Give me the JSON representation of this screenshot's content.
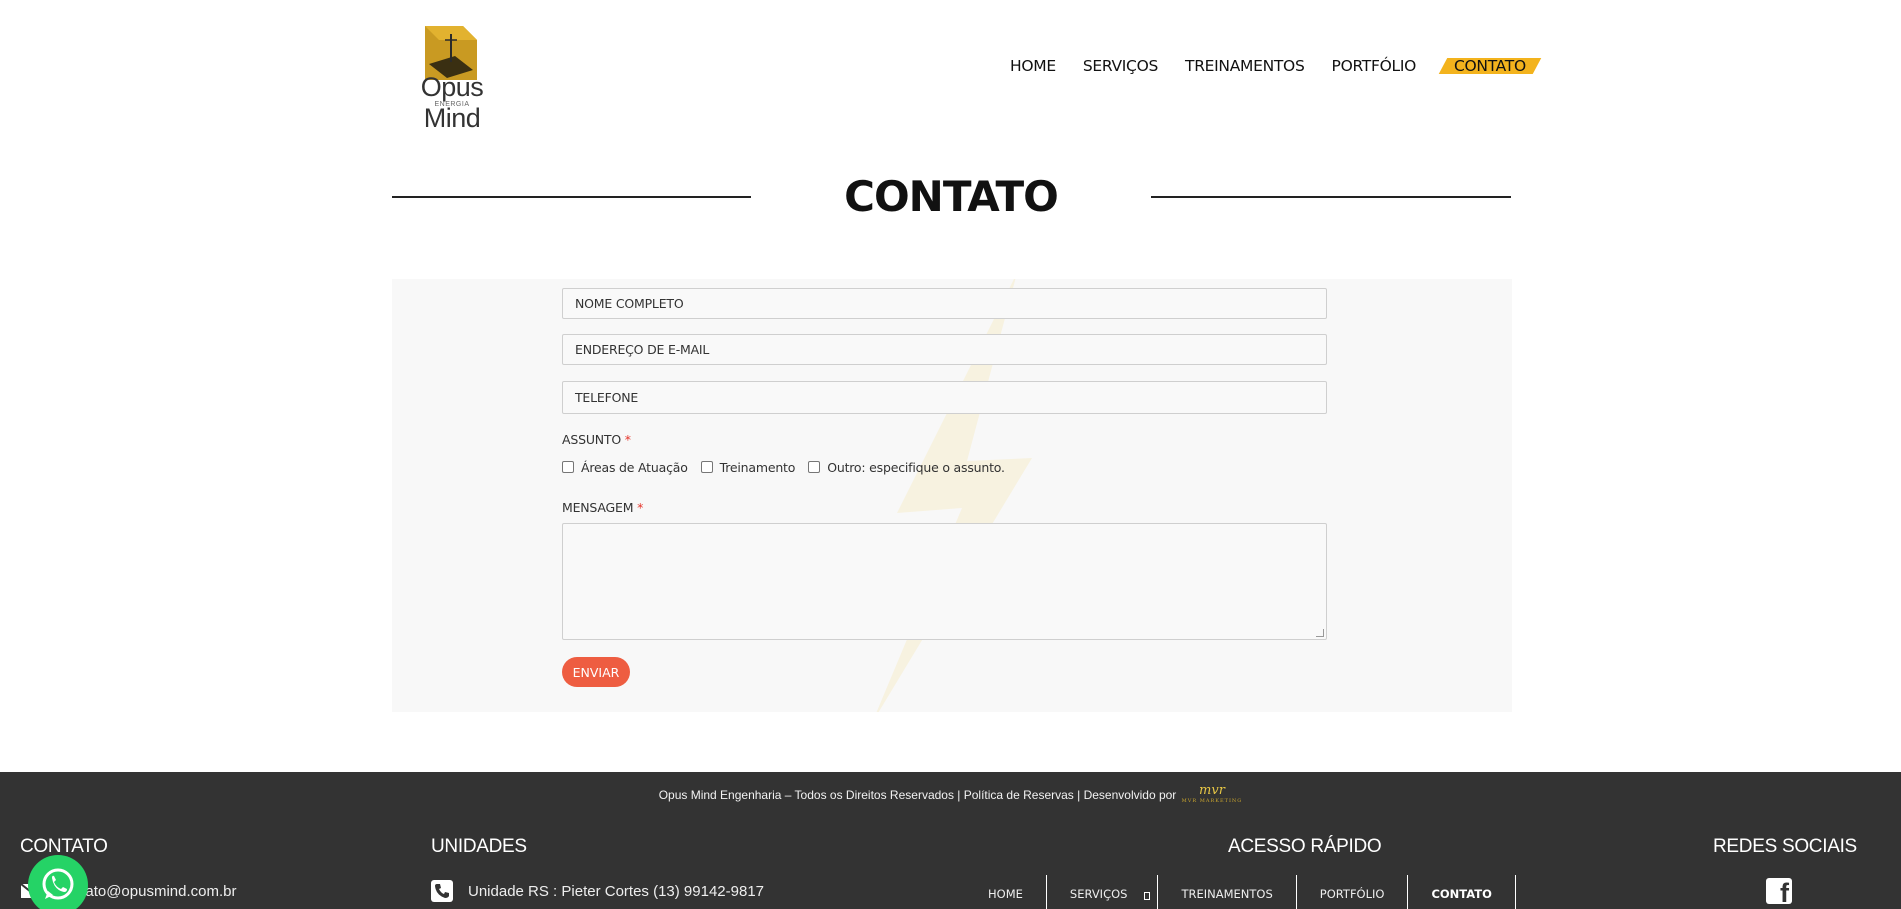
{
  "brand": {
    "name": "Opus Mind",
    "sub": "ENERGIA",
    "accent_color": "#f3b31d"
  },
  "nav": {
    "items": [
      {
        "label": "HOME"
      },
      {
        "label": "SERVIÇOS"
      },
      {
        "label": "TREINAMENTOS"
      },
      {
        "label": "PORTFÓLIO"
      },
      {
        "label": "CONTATO",
        "active": true
      }
    ]
  },
  "page": {
    "title": "CONTATO"
  },
  "form": {
    "name_placeholder": "NOME COMPLETO",
    "email_placeholder": "ENDEREÇO DE E-MAIL",
    "phone_placeholder": "TELEFONE",
    "subject_label": "ASSUNTO",
    "required_mark": "*",
    "subject_options": [
      "Áreas de Atuação",
      "Treinamento",
      "Outro: especifique o assunto."
    ],
    "message_label": "MENSAGEM",
    "message_value": "",
    "submit_label": "ENVIAR",
    "submit_color": "#ee5d41"
  },
  "footer": {
    "bg_color": "#333333",
    "copyright": "Opus Mind Engenharia – Todos os Direitos Reservados | Política de Reservas | Desenvolvido por",
    "developer_logo": "mvr",
    "developer_sub": "MVR MARKETING",
    "contact_heading": "CONTATO",
    "contact_email": "contato@opusmind.com.br",
    "units_heading": "UNIDADES",
    "unit_rs": "Unidade RS : Pieter Cortes (13) 99142-9817",
    "quick_heading": "ACESSO RÁPIDO",
    "quick_links": [
      {
        "label": "HOME"
      },
      {
        "label": "SERVIÇOS"
      },
      {
        "label": "TREINAMENTOS"
      },
      {
        "label": "PORTFÓLIO"
      },
      {
        "label": "CONTATO",
        "active": true
      }
    ],
    "social_heading": "REDES SOCIAIS",
    "social_icons": [
      "facebook-icon"
    ]
  },
  "floating": {
    "whatsapp_icon": "whatsapp-icon",
    "whatsapp_color": "#25d366"
  }
}
